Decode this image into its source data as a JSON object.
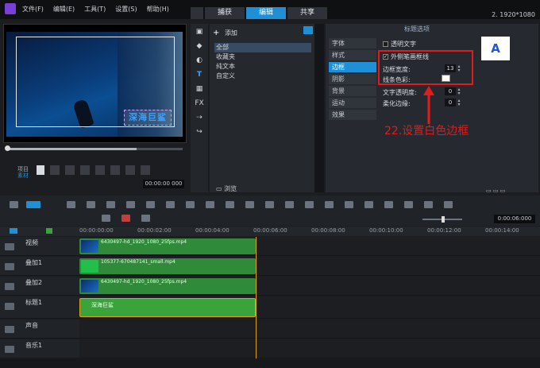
{
  "menu": [
    "文件(F)",
    "编辑(E)",
    "工具(T)",
    "设置(S)",
    "帮助(H)"
  ],
  "tabs": [
    "捕获",
    "编辑",
    "共享"
  ],
  "resolution": "2. 1920*1080",
  "preview": {
    "title_text": "深海巨鲨",
    "project_label": "项目",
    "clip_label": "素材",
    "timecode": "00:00:00 000"
  },
  "library": {
    "add_label": "添加",
    "items": [
      "全部",
      "收藏夹",
      "纯文本",
      "自定义"
    ],
    "browse_label": "浏览"
  },
  "options": {
    "title": "标题选项",
    "tabs": [
      "字体",
      "样式",
      "边框",
      "阴影",
      "背景",
      "运动",
      "效果"
    ],
    "transparent_text": "透明文字",
    "outer_stroke": "外侧笔画框线",
    "border_width_label": "边框宽度:",
    "border_width_value": "13",
    "line_color_label": "线条色彩:",
    "text_opacity_label": "文字透明度:",
    "text_opacity_value": "0",
    "soft_edge_label": "柔化边缘:",
    "soft_edge_value": "0",
    "preset_letter": "A"
  },
  "annotation": "22.设置白色边框",
  "timeline": {
    "timecode": "0:00:06:000",
    "ruler": [
      "00:00:00:00",
      "00:00:02:00",
      "00:00:04:00",
      "00:00:06:00",
      "00:00:08:00",
      "00:00:10:00",
      "00:00:12:00",
      "00:00:14:00"
    ],
    "tracks": [
      {
        "name": "视频",
        "clip": "6430497-hd_1920_1080_25fps.mp4"
      },
      {
        "name": "叠加1",
        "clip": "105377-670487141_small.mp4"
      },
      {
        "name": "叠加2",
        "clip": "6430497-hd_1920_1080_25fps.mp4"
      },
      {
        "name": "标题1",
        "clip": "深海巨鲨"
      },
      {
        "name": "声音",
        "clip": ""
      },
      {
        "name": "音乐1",
        "clip": ""
      }
    ]
  },
  "colors": {
    "accent": "#1f8fd6",
    "annotation": "#e21b1b",
    "clip_green": "#3aa33a"
  }
}
